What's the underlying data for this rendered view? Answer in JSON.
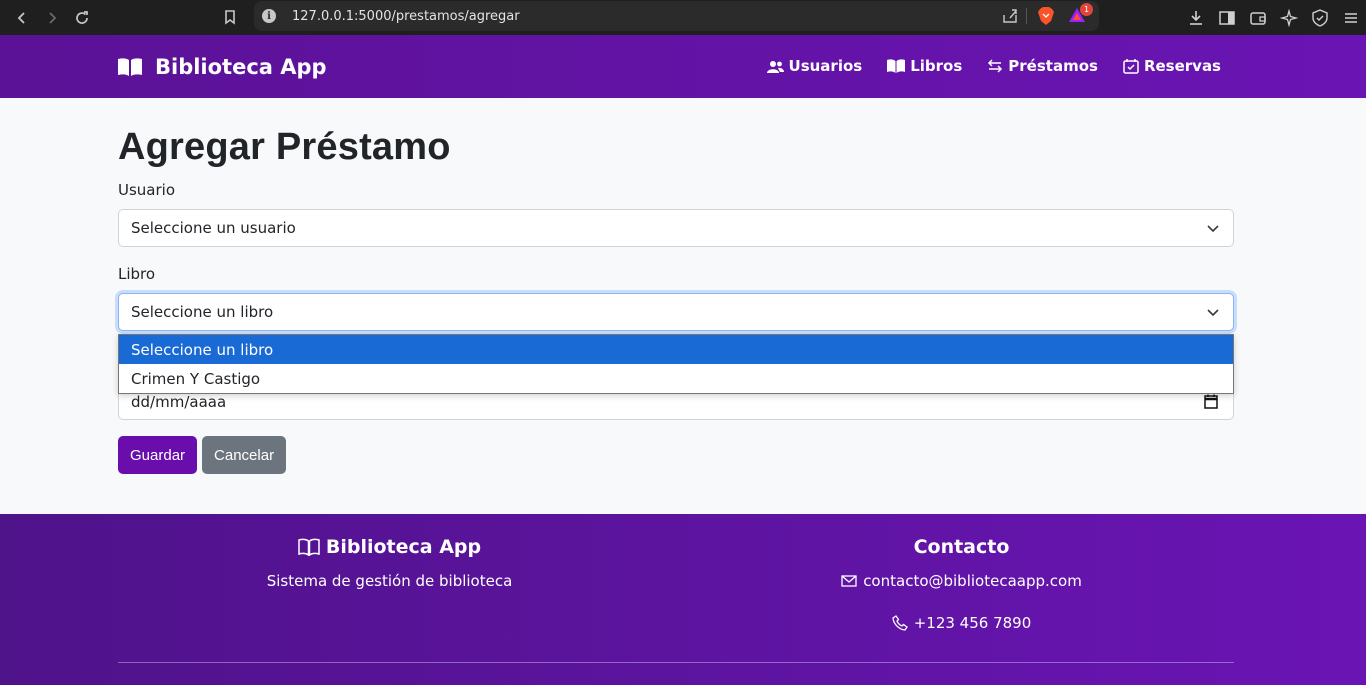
{
  "browser": {
    "url": "127.0.0.1:5000/prestamos/agregar",
    "badge_count": "1"
  },
  "navbar": {
    "brand": "Biblioteca App",
    "links": [
      {
        "label": "Usuarios",
        "icon": "users-icon"
      },
      {
        "label": "Libros",
        "icon": "book-icon"
      },
      {
        "label": "Préstamos",
        "icon": "exchange-icon"
      },
      {
        "label": "Reservas",
        "icon": "calendar-check-icon"
      }
    ]
  },
  "form": {
    "title": "Agregar Préstamo",
    "usuario_label": "Usuario",
    "usuario_value": "Seleccione un usuario",
    "libro_label": "Libro",
    "libro_value": "Seleccione un libro",
    "libro_options": [
      "Seleccione un libro",
      "Crimen Y Castigo"
    ],
    "fecha_placeholder": "dd/mm/aaaa",
    "save_label": "Guardar",
    "cancel_label": "Cancelar"
  },
  "footer": {
    "brand": "Biblioteca App",
    "tagline": "Sistema de gestión de biblioteca",
    "contact_title": "Contacto",
    "email": "contacto@bibliotecaapp.com",
    "phone": "+123 456 7890"
  },
  "colors": {
    "primary": "#6a0dad",
    "navbar": "#5b1296",
    "option_highlight": "#1a6ad6",
    "secondary": "#6c757d"
  }
}
